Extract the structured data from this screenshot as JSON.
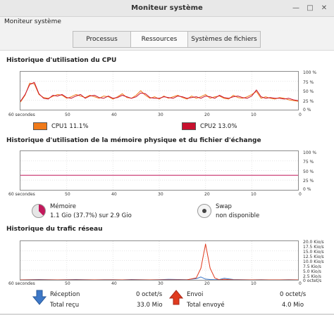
{
  "window": {
    "title": "Moniteur système",
    "minimize_icon": "minimize-icon",
    "maximize_icon": "maximize-icon",
    "close_icon": "close-icon"
  },
  "menu": {
    "app_label": "Moniteur système"
  },
  "tabs": [
    {
      "label": "Processus",
      "active": false
    },
    {
      "label": "Ressources",
      "active": true
    },
    {
      "label": "Systèmes de fichiers",
      "active": false
    }
  ],
  "cpu": {
    "title": "Historique d'utilisation du CPU",
    "y_ticks": [
      "100 %",
      "75 %",
      "50 %",
      "25 %",
      "0 %"
    ],
    "x_ticks": [
      "60 secondes",
      "50",
      "40",
      "30",
      "20",
      "10",
      "0"
    ],
    "cpu1": {
      "label": "CPU1",
      "value": "11.1%",
      "color": "#f07a1a"
    },
    "cpu2": {
      "label": "CPU2",
      "value": "13.0%",
      "color": "#c8102e"
    }
  },
  "memory": {
    "title": "Historique d'utilisation de la mémoire physique et du fichier d'échange",
    "y_ticks": [
      "100 %",
      "75 %",
      "50 %",
      "25 %",
      "0 %"
    ],
    "x_ticks": [
      "60 secondes",
      "50",
      "40",
      "30",
      "20",
      "10",
      "0"
    ],
    "ram": {
      "label": "Mémoire",
      "detail": "1.1 Gio (37.7%) sur 2.9 Gio",
      "color": "#c2185b"
    },
    "swap": {
      "label": "Swap",
      "detail": "non disponible"
    }
  },
  "network": {
    "title": "Historique du trafic réseau",
    "y_ticks": [
      "20.0 Kio/s",
      "17.5 Kio/s",
      "15.0 Kio/s",
      "12.5 Kio/s",
      "10.0 Kio/s",
      "7.5 Kio/s",
      "5.0 Kio/s",
      "2.5 Kio/s",
      "0 octet/s"
    ],
    "x_ticks": [
      "60 secondes",
      "50",
      "40",
      "30",
      "20",
      "10",
      "0"
    ],
    "receive": {
      "label": "Réception",
      "rate": "0 octet/s",
      "total_label": "Total reçu",
      "total": "33.0 Mio",
      "color": "#3d78c8"
    },
    "send": {
      "label": "Envoi",
      "rate": "0 octet/s",
      "total_label": "Total envoyé",
      "total": "4.0 Mio",
      "color": "#e03a1e"
    }
  },
  "chart_data": [
    {
      "type": "line",
      "title": "Historique d'utilisation du CPU",
      "xlabel": "",
      "ylabel": "",
      "xlim": [
        60,
        0
      ],
      "ylim": [
        0,
        100
      ],
      "x": [
        60,
        59,
        58,
        57,
        56,
        55,
        54,
        53,
        52,
        51,
        50,
        49,
        48,
        47,
        46,
        45,
        44,
        43,
        42,
        41,
        40,
        39,
        38,
        37,
        36,
        35,
        34,
        33,
        32,
        31,
        30,
        29,
        28,
        27,
        26,
        25,
        24,
        23,
        22,
        21,
        20,
        19,
        18,
        17,
        16,
        15,
        14,
        13,
        12,
        11,
        10,
        9,
        8,
        7,
        6,
        5,
        4,
        3,
        2,
        1,
        0
      ],
      "series": [
        {
          "name": "CPU1",
          "color": "#f07a1a",
          "values": [
            20,
            38,
            70,
            68,
            40,
            32,
            30,
            35,
            40,
            38,
            30,
            34,
            40,
            36,
            32,
            38,
            34,
            30,
            36,
            34,
            28,
            34,
            42,
            32,
            30,
            38,
            50,
            38,
            30,
            34,
            28,
            36,
            30,
            34,
            38,
            32,
            28,
            36,
            30,
            34,
            40,
            30,
            34,
            36,
            30,
            28,
            38,
            32,
            30,
            34,
            40,
            48,
            30,
            34,
            30,
            28,
            32,
            30,
            26,
            24,
            22
          ]
        },
        {
          "name": "CPU2",
          "color": "#c8102e",
          "values": [
            22,
            40,
            66,
            72,
            42,
            30,
            28,
            38,
            36,
            40,
            32,
            30,
            36,
            40,
            30,
            36,
            38,
            32,
            30,
            36,
            30,
            32,
            38,
            34,
            30,
            34,
            44,
            42,
            32,
            30,
            30,
            34,
            32,
            30,
            36,
            34,
            30,
            32,
            34,
            30,
            36,
            34,
            30,
            38,
            32,
            30,
            34,
            36,
            32,
            30,
            36,
            52,
            34,
            30,
            32,
            30,
            30,
            28,
            30,
            26,
            24
          ]
        }
      ]
    },
    {
      "type": "line",
      "title": "Historique d'utilisation de la mémoire physique et du fichier d'échange",
      "xlabel": "",
      "ylabel": "",
      "xlim": [
        60,
        0
      ],
      "ylim": [
        0,
        100
      ],
      "x": [
        60,
        0
      ],
      "series": [
        {
          "name": "Mémoire",
          "color": "#c2185b",
          "values": [
            37.7,
            37.7
          ]
        }
      ]
    },
    {
      "type": "line",
      "title": "Historique du trafic réseau",
      "xlabel": "",
      "ylabel": "",
      "xlim": [
        60,
        0
      ],
      "ylim": [
        0,
        20
      ],
      "x": [
        60,
        58,
        56,
        54,
        52,
        50,
        48,
        46,
        44,
        42,
        40,
        38,
        36,
        34,
        32,
        30,
        28,
        26,
        24,
        22,
        21,
        20,
        19,
        18,
        17,
        16,
        14,
        12,
        10,
        8,
        6,
        4,
        2,
        0
      ],
      "series": [
        {
          "name": "Réception",
          "color": "#3d78c8",
          "values": [
            0,
            0.1,
            0.2,
            0.1,
            0,
            0.1,
            0.2,
            0.1,
            0,
            0.1,
            0.1,
            0,
            0.2,
            0.1,
            0,
            0.1,
            0.3,
            0.2,
            0.1,
            0.6,
            1.5,
            0.4,
            0.2,
            0.1,
            0.2,
            0.8,
            0.2,
            0.1,
            0,
            0.1,
            0,
            0,
            0.1,
            0
          ]
        },
        {
          "name": "Envoi",
          "color": "#e03a1e",
          "values": [
            0,
            0,
            0,
            0,
            0,
            0,
            0,
            0,
            0,
            0,
            0,
            0,
            0,
            0,
            0,
            0,
            0,
            0,
            0,
            1.0,
            6.0,
            18.5,
            6.0,
            1.0,
            0,
            0.3,
            0,
            0,
            0,
            0,
            0,
            0,
            0,
            0
          ]
        }
      ]
    }
  ]
}
